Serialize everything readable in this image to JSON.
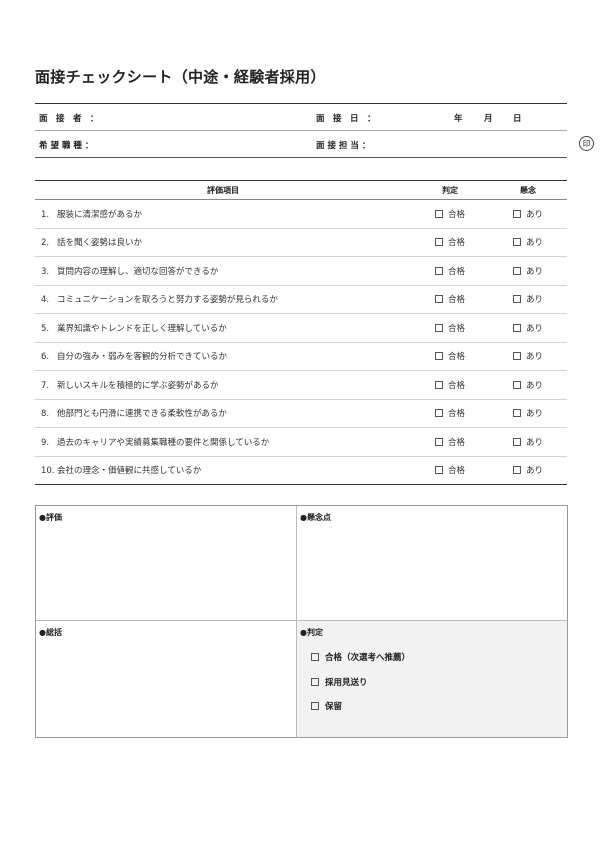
{
  "title": "面接チェックシート（中途・経験者採用）",
  "info": {
    "interviewer": "面　接　者　：",
    "date_label": "面　接　日　：",
    "year": "年",
    "month": "月",
    "day": "日",
    "desired_job": "希 望 職 種 ：",
    "person_in_charge": "面 接 担 当 ：",
    "seal": "印"
  },
  "table": {
    "headers": [
      "評価項目",
      "判定",
      "懸念"
    ],
    "items": [
      {
        "num": "1.",
        "text": "服装に清潔感があるか"
      },
      {
        "num": "2.",
        "text": "話を聞く姿勢は良いか"
      },
      {
        "num": "3.",
        "text": "質問内容の理解し、適切な回答ができるか"
      },
      {
        "num": "4.",
        "text": "コミュニケーションを取ろうと努力する姿勢が見られるか"
      },
      {
        "num": "5.",
        "text": "業界知識やトレンドを正しく理解しているか"
      },
      {
        "num": "6.",
        "text": "自分の強み・弱みを客観的分析できているか"
      },
      {
        "num": "7.",
        "text": "新しいスキルを積極的に学ぶ姿勢があるか"
      },
      {
        "num": "8.",
        "text": "他部門とも円滑に連携できる柔軟性があるか"
      },
      {
        "num": "9.",
        "text": "過去のキャリアや実績募集職種の要件と関係しているか"
      },
      {
        "num": "10.",
        "text": "会社の理念・価値観に共感しているか"
      }
    ],
    "pass_label": "合格",
    "concern_label": "あり"
  },
  "sections": {
    "evaluation": "●評価",
    "concerns": "●懸念点",
    "summary": "●総括",
    "decision": "●判定"
  },
  "decision_options": [
    "合格（次選考へ推薦）",
    "採用見送り",
    "保留"
  ],
  "colors": {
    "decision_bg": "#f2f2f2",
    "rule": "#333333"
  }
}
